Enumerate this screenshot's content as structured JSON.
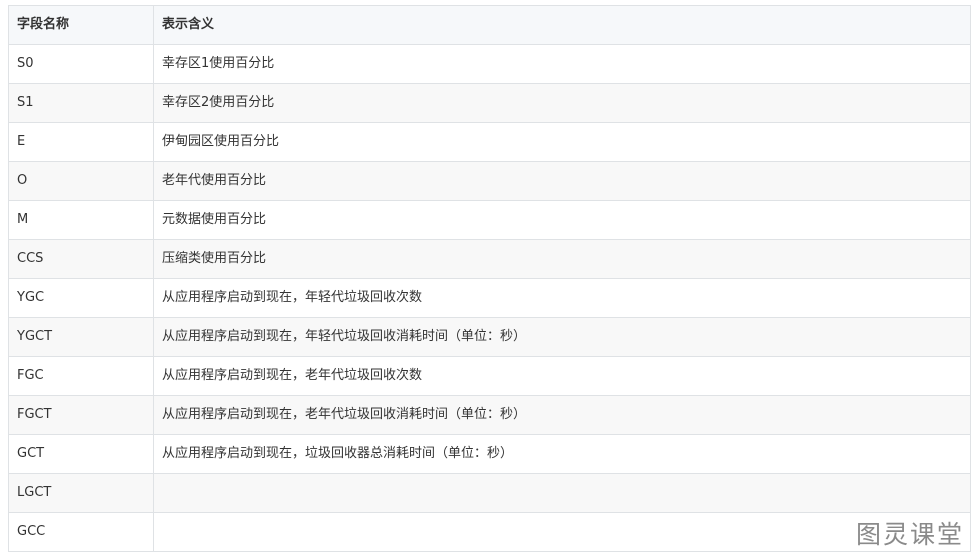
{
  "table": {
    "headers": [
      "字段名称",
      "表示含义"
    ],
    "rows": [
      [
        "S0",
        "幸存区1使用百分比"
      ],
      [
        "S1",
        "幸存区2使用百分比"
      ],
      [
        "E",
        "伊甸园区使用百分比"
      ],
      [
        "O",
        "老年代使用百分比"
      ],
      [
        "M",
        "元数据使用百分比"
      ],
      [
        "CCS",
        "压缩类使用百分比"
      ],
      [
        "YGC",
        "从应用程序启动到现在，年轻代垃圾回收次数"
      ],
      [
        "YGCT",
        "从应用程序启动到现在，年轻代垃圾回收消耗时间（单位：秒）"
      ],
      [
        "FGC",
        "从应用程序启动到现在，老年代垃圾回收次数"
      ],
      [
        "FGCT",
        "从应用程序启动到现在，老年代垃圾回收消耗时间（单位：秒）"
      ],
      [
        "GCT",
        "从应用程序启动到现在，垃圾回收器总消耗时间（单位：秒）"
      ],
      [
        "LGCT",
        ""
      ],
      [
        "GCC",
        ""
      ]
    ]
  },
  "watermark": "图灵课堂"
}
